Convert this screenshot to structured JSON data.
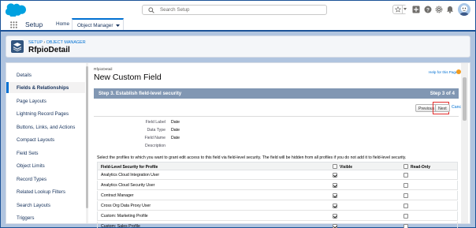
{
  "header": {
    "search_placeholder": "Search Setup"
  },
  "nav": {
    "app_name": "Setup",
    "tabs": [
      {
        "label": "Home"
      },
      {
        "label": "Object Manager",
        "selected": true
      }
    ]
  },
  "page_header": {
    "breadcrumb_setup": "SETUP",
    "breadcrumb_sep": " › ",
    "breadcrumb_object_manager": "OBJECT MANAGER",
    "title": "RfpioDetail"
  },
  "sidebar": {
    "items": [
      {
        "label": "Details"
      },
      {
        "label": "Fields & Relationships",
        "selected": true
      },
      {
        "label": "Page Layouts"
      },
      {
        "label": "Lightning Record Pages"
      },
      {
        "label": "Buttons, Links, and Actions"
      },
      {
        "label": "Compact Layouts"
      },
      {
        "label": "Field Sets"
      },
      {
        "label": "Object Limits"
      },
      {
        "label": "Record Types"
      },
      {
        "label": "Related Lookup Filters"
      },
      {
        "label": "Search Layouts"
      },
      {
        "label": "Triggers"
      }
    ]
  },
  "main": {
    "context": "RfpioDetail",
    "title": "New Custom Field",
    "help_link": "Help for this Page",
    "step_title": "Step 3. Establish field-level security",
    "step_count": "Step 3 of 4",
    "previous_label": "Previous",
    "next_label": "Next",
    "cancel_label": "Cancel",
    "fields": [
      {
        "label": "Field Label",
        "value": "Date"
      },
      {
        "label": "Data Type",
        "value": "Date"
      },
      {
        "label": "Field Name",
        "value": "Date"
      },
      {
        "label": "Description",
        "value": ""
      }
    ],
    "instructions": "Select the profiles to which you want to grant edit access to this field via field-level security. The field will be hidden from all profiles if you do not add it to field-level security.",
    "table": {
      "col_profile": "Field-Level Security for Profile",
      "col_visible": "Visible",
      "col_readonly": "Read-Only",
      "rows": [
        {
          "profile": "Analytics Cloud Integration User",
          "visible": true,
          "read_only": false
        },
        {
          "profile": "Analytics Cloud Security User",
          "visible": true,
          "read_only": false
        },
        {
          "profile": "Contract Manager",
          "visible": true,
          "read_only": false
        },
        {
          "profile": "Cross Org Data Proxy User",
          "visible": true,
          "read_only": false
        },
        {
          "profile": "Custom: Marketing Profile",
          "visible": true,
          "read_only": false
        },
        {
          "profile": "Custom: Sales Profile",
          "visible": true,
          "read_only": false
        }
      ]
    }
  },
  "colors": {
    "brand_blue": "#0070d2",
    "step_bar": "#8197b3",
    "highlight_box": "#e32c2c",
    "page_bg": "#b0c4df"
  }
}
